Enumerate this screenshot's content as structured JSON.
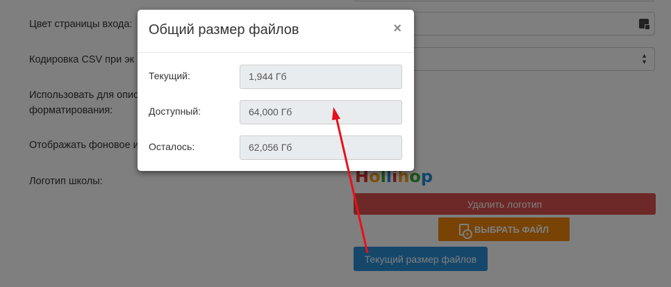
{
  "form": {
    "login_color_label": "Цвет страницы входа:",
    "csv_encoding_label": "Кодировка CSV при эк",
    "use_for_label_line1": "Использовать для опис",
    "use_for_label_line2": "форматирования:",
    "show_bg_label": "Отображать фоновое и",
    "school_logo_label": "Логотип школы:"
  },
  "logo": {
    "text": "Hollihop",
    "letter_colors": [
      "#e0312b",
      "#f6a21c",
      "#3aa935",
      "#1f8fd8",
      "#e0312b",
      "#f6a21c",
      "#3aa935",
      "#1f8fd8"
    ]
  },
  "buttons": {
    "delete_logo": "Удалить логотип",
    "choose_file": "ВЫБРАТЬ ФАЙЛ",
    "current_size": "Текущий размер файлов"
  },
  "modal": {
    "title": "Общий размер файлов",
    "close": "×",
    "rows": [
      {
        "label": "Текущий:",
        "value": "1,944 Гб"
      },
      {
        "label": "Доступный:",
        "value": "64,000 Гб"
      },
      {
        "label": "Осталось:",
        "value": "62,056 Гб"
      }
    ]
  },
  "colors": {
    "danger": "#d9534f",
    "orange": "#f0870a",
    "primary": "#2b8fd6",
    "arrow": "#e8101a"
  }
}
